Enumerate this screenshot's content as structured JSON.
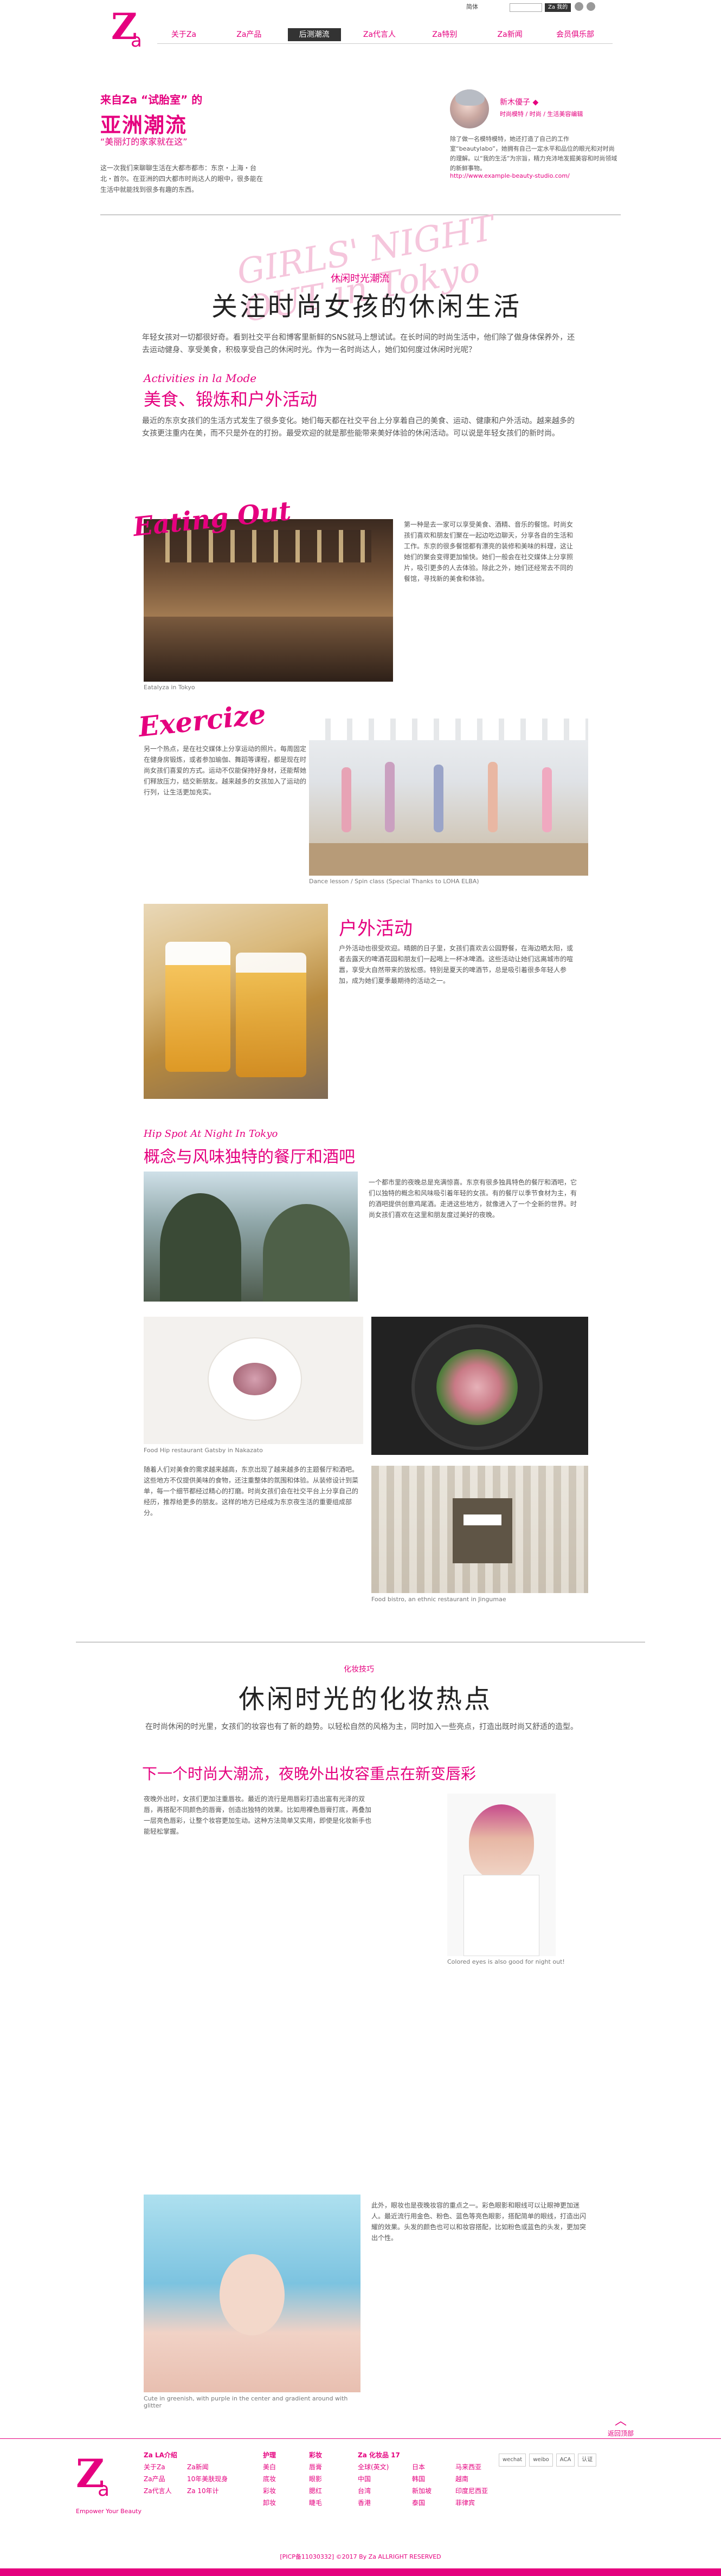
{
  "topbar": {
    "lang": "简体",
    "fav": "Za 我的"
  },
  "nav": [
    {
      "label": "关于Za",
      "active": false
    },
    {
      "label": "Za产品",
      "active": false
    },
    {
      "label": "后测潮流",
      "active": true
    },
    {
      "label": "Za代言人",
      "active": false
    },
    {
      "label": "Za特别",
      "active": false
    },
    {
      "label": "Za新闻",
      "active": false
    },
    {
      "label": "会员俱乐部",
      "active": false
    }
  ],
  "header": {
    "tag": "来自Za “试胎室” 的",
    "title": "亚洲潮流",
    "subtitle": "“美丽灯的家家就在这”",
    "desc": "这一次我们来聊聊生活在大都市都市：东京・上海・台北・首尔。在亚洲的四大都市时尚达人的眼中，很多能在生活中就能找到很多有趣的东西。"
  },
  "author": {
    "name": "新木優子 ◆",
    "role": "时尚模特 / 时尚 / 生活美容编辑",
    "desc": "除了做一名模特模特，她还打造了自己的工作室“beautylabo”，她拥有自己一定水平和品位的眼光和对时尚的理解。以“我的生活”为宗旨，精力充沛地发掘美容和时尚领域的新鲜事物。",
    "link": "http://www.example-beauty-studio.com/"
  },
  "section1": {
    "tag": "休闲时光潮流",
    "title": "关注时尚女孩的休闲生活",
    "intro": "年轻女孩对一切都很好奇。看到社交平台和博客里新鲜的SNS就马上想试试。在长时间的时尚生活中，他们除了做身体保养外，还去运动健身、享受美食，积极享受自己的休闲时光。作为一名时尚达人，她们如何度过休闲时光呢？",
    "bg_script": "GIRLS' NIGHT OUT in Tokyo",
    "script": "Activities in la Mode",
    "sub": "美食、锻炼和户外活动",
    "body": "最近的东京女孩们的生活方式发生了很多变化。她们每天都在社交平台上分享着自己的美食、运动、健康和户外活动。越来越多的女孩更注重内在美，而不只是外在的打扮。最受欢迎的就是那些能带来美好体验的休闲活动。可以说是年轻女孩们的新时尚。"
  },
  "eating": {
    "script": "Eating Out",
    "caption": "Eatalyza in Tokyo",
    "text": "第一种是去一家可以享受美食、酒精、音乐的餐馆。时尚女孩们喜欢和朋友们聚在一起边吃边聊天，分享各自的生活和工作。东京的很多餐馆都有漂亮的装修和美味的料理，这让她们的聚会变得更加愉快。她们一般会在社交媒体上分享照片，吸引更多的人去体验。除此之外，她们还经常去不同的餐馆，寻找新的美食和体验。"
  },
  "exercise": {
    "script": "Exercize",
    "caption": "Dance lesson / Spin class (Special Thanks to LOHA ELBA)",
    "text": "另一个热点，是在社交媒体上分享运动的照片。每周固定在健身房锻炼，或者参加瑜伽、舞蹈等课程，都是现在时尚女孩们喜爱的方式。运动不仅能保持好身材，还能帮她们释放压力，结交新朋友。越来越多的女孩加入了运动的行列，让生活更加充实。"
  },
  "outdoor": {
    "title": "户外活动",
    "text": "户外活动也很受欢迎。晴朗的日子里，女孩们喜欢去公园野餐，在海边晒太阳，或者去露天的啤酒花园和朋友们一起喝上一杯冰啤酒。这些活动让她们远离城市的喧嚣，享受大自然带来的放松感。特别是夏天的啤酒节，总是吸引着很多年轻人参加，成为她们夏季最期待的活动之一。"
  },
  "hotspot": {
    "script": "Hip Spot At Night In Tokyo",
    "title": "概念与风味独特的餐厅和酒吧",
    "text1": "一个都市里的夜晚总是充满惊喜。东京有很多独具特色的餐厅和酒吧，它们以独特的概念和风味吸引着年轻的女孩。有的餐厅以季节食材为主，有的酒吧提供创意鸡尾酒。走进这些地方，就像进入了一个全新的世界。时尚女孩们喜欢在这里和朋友度过美好的夜晚。",
    "caption1": "Food Hip restaurant Gatsby in Nakazato",
    "text2": "随着人们对美食的需求越来越高，东京出现了越来越多的主题餐厅和酒吧。这些地方不仅提供美味的食物，还注重整体的氛围和体验。从装修设计到菜单，每一个细节都经过精心的打磨。时尚女孩们会在社交平台上分享自己的经历，推荐给更多的朋友。这样的地方已经成为东京夜生活的重要组成部分。",
    "caption2": "Food bistro, an ethnic restaurant in Jingumae"
  },
  "makeup": {
    "tag": "化妆技巧",
    "title": "休闲时光的化妆热点",
    "intro": "在时尚休闲的时光里，女孩们的妆容也有了新的趋势。以轻松自然的风格为主，同时加入一些亮点，打造出既时尚又舒适的造型。",
    "sub": "下一个时尚大潮流，夜晚外出妆容重点在新变唇彩",
    "text1": "夜晚外出时，女孩们更加注重唇妆。最近的流行是用唇彩打造出富有光泽的双唇，再搭配不同颜色的唇膏，创造出独特的效果。比如用裸色唇膏打底，再叠加一层亮色唇彩，让整个妆容更加生动。这种方法简单又实用，即使是化妆新手也能轻松掌握。",
    "caption1": "Colored eyes is also good for night out!",
    "text2": "此外，眼妆也是夜晚妆容的重点之一。彩色眼影和眼线可以让眼神更加迷人。最近流行用金色、粉色、蓝色等亮色眼影，搭配简单的眼线，打造出闪耀的效果。头发的颜色也可以和妆容搭配，比如粉色或蓝色的头发，更加突出个性。",
    "caption2": "Cute in greenish, with purple in the center and gradient around with glitter"
  },
  "totop": "返回顶部",
  "footer": {
    "tagline": "Empower Your Beauty",
    "col1": [
      "Za LA介绍",
      "关于Za",
      "Za产品",
      "Za代言人"
    ],
    "col2": [
      "",
      "Za新闻",
      "10年美肤现身",
      "Za 10年计"
    ],
    "col3": [
      "护理",
      "美白",
      "底妆",
      "彩妆",
      "卸妆"
    ],
    "col4": [
      "彩妆",
      "唇膏",
      "眼影",
      "腮红",
      "睫毛"
    ],
    "col5": [
      "Za 化妆品 17",
      "全球(英文)",
      "中国",
      "台湾",
      "香港"
    ],
    "col6": [
      "",
      "日本",
      "韩国",
      "新加坡",
      "泰国"
    ],
    "col7": [
      "",
      "马来西亚",
      "越南",
      "印度尼西亚",
      "菲律宾"
    ],
    "badges": [
      "wechat",
      "weibo",
      "ACA",
      "认证"
    ],
    "copyright": "[PICP备11030332] ©2017 By Za ALLRIGHT RESERVED"
  },
  "colors": {
    "accent": "#e5007f",
    "dark": "#333333"
  }
}
